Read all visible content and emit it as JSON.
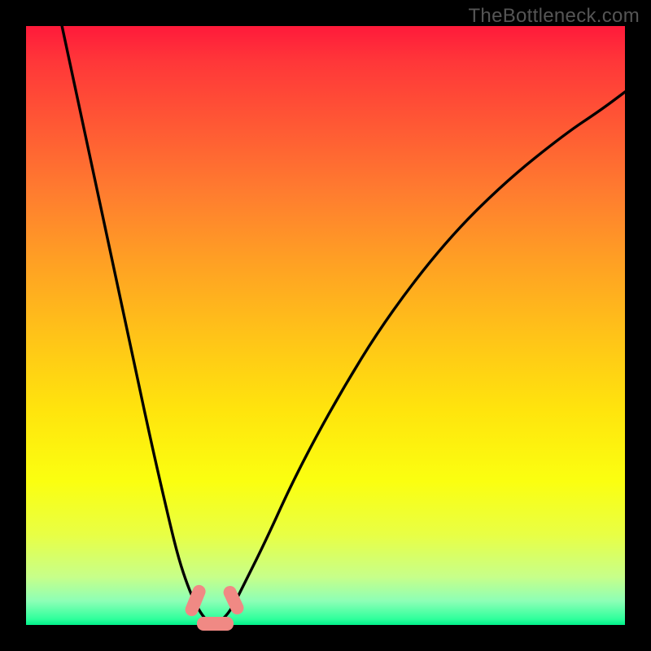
{
  "watermark": "TheBottleneck.com",
  "chart_data": {
    "type": "line",
    "title": "",
    "xlabel": "",
    "ylabel": "",
    "xlim": [
      0,
      1
    ],
    "ylim": [
      0,
      1
    ],
    "series": [
      {
        "name": "left-curve",
        "x": [
          0.06,
          0.09,
          0.12,
          0.15,
          0.18,
          0.21,
          0.24,
          0.255,
          0.27,
          0.283,
          0.295,
          0.305,
          0.316
        ],
        "y": [
          1.0,
          0.86,
          0.72,
          0.58,
          0.44,
          0.3,
          0.17,
          0.11,
          0.065,
          0.035,
          0.015,
          0.005,
          0.0
        ]
      },
      {
        "name": "right-curve",
        "x": [
          0.316,
          0.33,
          0.345,
          0.36,
          0.4,
          0.45,
          0.52,
          0.6,
          0.7,
          0.8,
          0.9,
          0.96,
          1.0
        ],
        "y": [
          0.0,
          0.01,
          0.03,
          0.06,
          0.14,
          0.25,
          0.38,
          0.51,
          0.64,
          0.74,
          0.82,
          0.86,
          0.89
        ]
      }
    ],
    "markers": [
      {
        "name": "left-glob",
        "cx": 0.283,
        "cy": 0.04,
        "w": 0.022,
        "h": 0.055,
        "angle": 22
      },
      {
        "name": "right-glob",
        "cx": 0.347,
        "cy": 0.042,
        "w": 0.022,
        "h": 0.05,
        "angle": -25
      },
      {
        "name": "bottom-bar",
        "cx": 0.316,
        "cy": 0.002,
        "w": 0.06,
        "h": 0.022,
        "angle": 0
      }
    ]
  }
}
